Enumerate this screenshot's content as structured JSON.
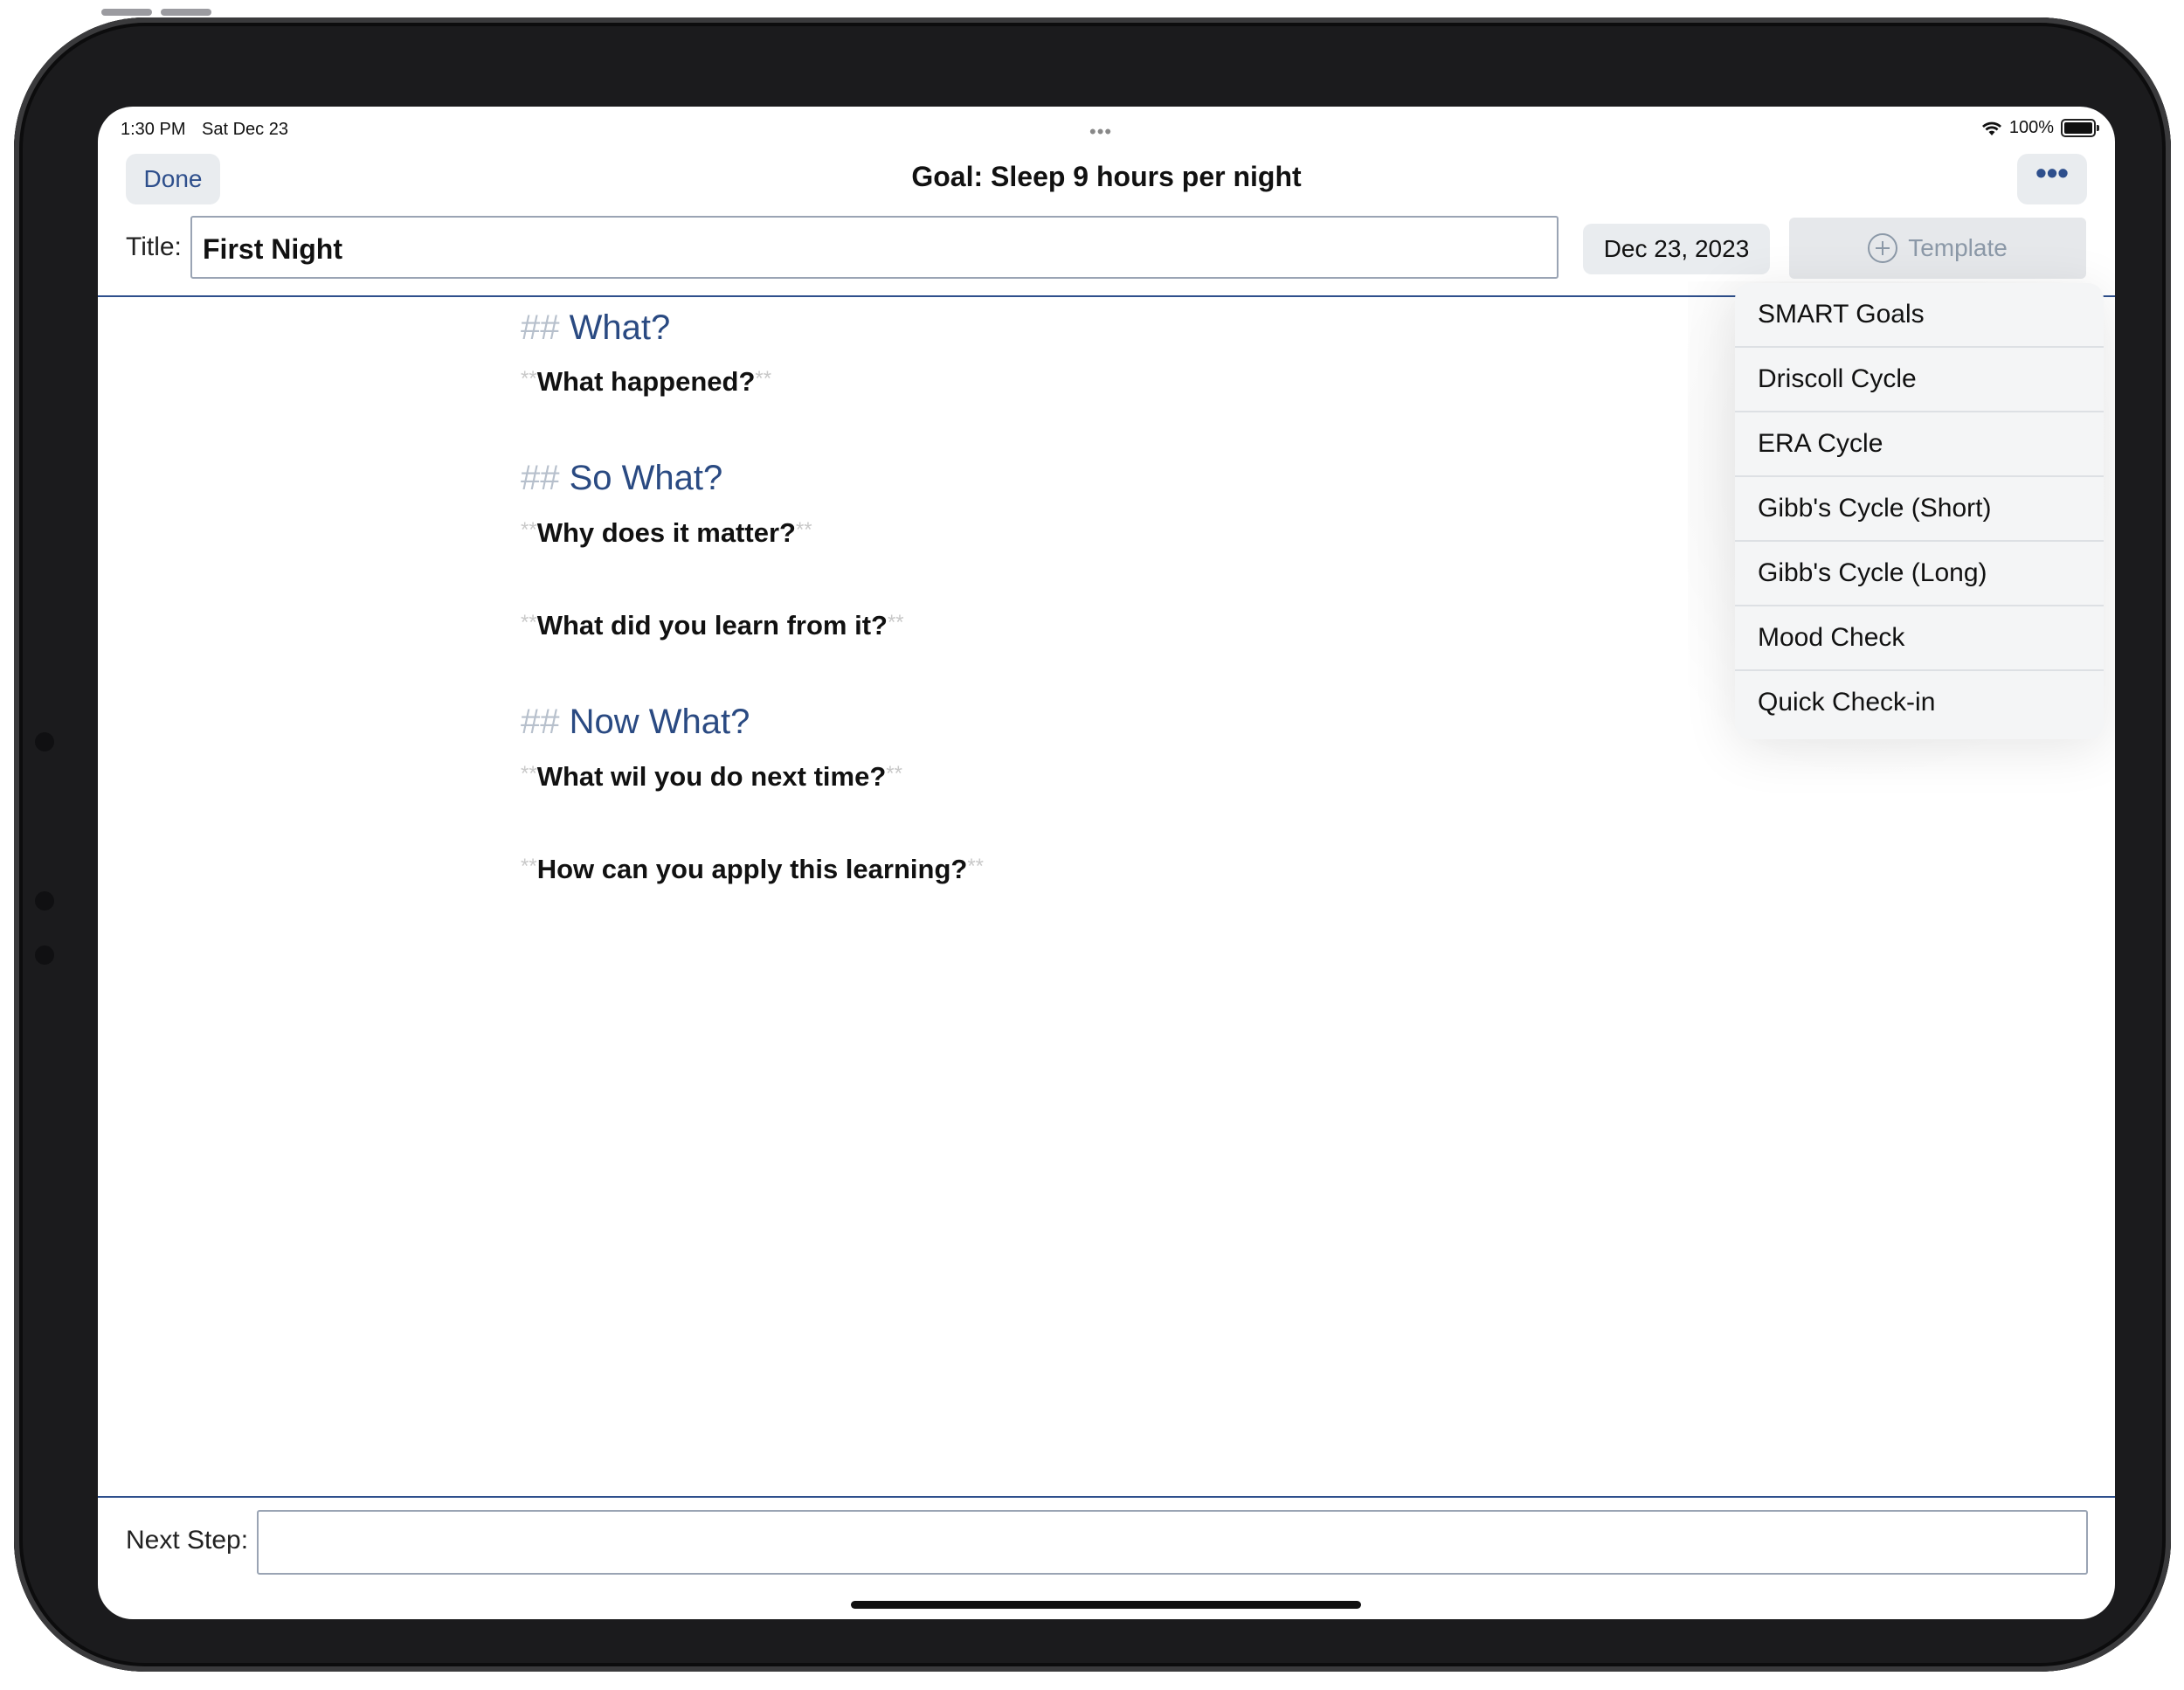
{
  "status_bar": {
    "time": "1:30 PM",
    "date": "Sat Dec 23",
    "multitask_dots": "•••",
    "battery": "100%"
  },
  "nav": {
    "done_label": "Done",
    "title": "Goal: Sleep 9 hours per night",
    "more_label": "•••"
  },
  "entry": {
    "title_label": "Title:",
    "title_value": "First Night",
    "date_label": "Dec 23, 2023",
    "template_label": "Template"
  },
  "editor": {
    "heading_marker": "##",
    "bold_marker": "**",
    "sections": [
      {
        "heading": "What?",
        "questions": [
          "What happened?"
        ]
      },
      {
        "heading": "So What?",
        "questions": [
          "Why does it matter?",
          "What did you learn from it?"
        ]
      },
      {
        "heading": "Now What?",
        "questions": [
          "What wil you do next time?",
          "How can you apply this learning?"
        ]
      }
    ]
  },
  "template_menu": {
    "items": [
      "SMART Goals",
      "Driscoll Cycle",
      "ERA Cycle",
      "Gibb's Cycle (Short)",
      "Gibb's Cycle (Long)",
      "Mood Check",
      "Quick Check-in"
    ]
  },
  "footer": {
    "next_step_label": "Next Step:",
    "next_step_value": ""
  },
  "colors": {
    "accent": "#2e4f8c",
    "heading": "#2a4a82",
    "markdown_marker": "#c9c9c9"
  }
}
